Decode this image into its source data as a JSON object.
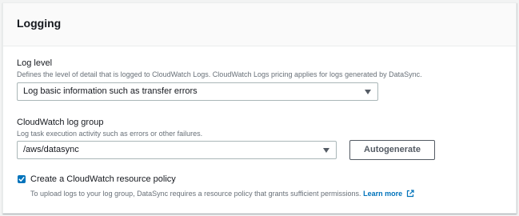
{
  "section": {
    "title": "Logging"
  },
  "log_level": {
    "label": "Log level",
    "description": "Defines the level of detail that is logged to CloudWatch Logs. CloudWatch Logs pricing applies for logs generated by DataSync.",
    "selected": "Log basic information such as transfer errors"
  },
  "log_group": {
    "label": "CloudWatch log group",
    "description": "Log task execution activity such as errors or other failures.",
    "selected": "/aws/datasync",
    "autogenerate_label": "Autogenerate"
  },
  "resource_policy": {
    "checked": true,
    "label": "Create a CloudWatch resource policy",
    "help": "To upload logs to your log group, DataSync requires a resource policy that grants sufficient permissions.",
    "learn_more": "Learn more"
  },
  "colors": {
    "accent": "#0073bb",
    "text": "#16191f",
    "secondary_text": "#687078",
    "border": "#aab7b8"
  }
}
